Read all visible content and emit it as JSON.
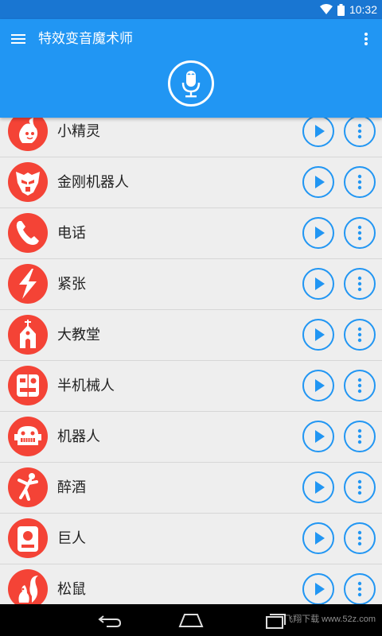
{
  "status": {
    "time": "10:32"
  },
  "appbar": {
    "title": "特效变音魔术师"
  },
  "list": {
    "items": [
      {
        "name": "小精灵",
        "icon": "fairy-icon"
      },
      {
        "name": "金刚机器人",
        "icon": "transformer-robot-icon"
      },
      {
        "name": "电话",
        "icon": "phone-icon"
      },
      {
        "name": "紧张",
        "icon": "lightning-icon"
      },
      {
        "name": "大教堂",
        "icon": "church-icon"
      },
      {
        "name": "半机械人",
        "icon": "cyborg-icon"
      },
      {
        "name": "机器人",
        "icon": "robot-icon"
      },
      {
        "name": "醉酒",
        "icon": "drunk-person-icon"
      },
      {
        "name": "巨人",
        "icon": "giant-icon"
      },
      {
        "name": "松鼠",
        "icon": "squirrel-icon"
      }
    ]
  },
  "watermark": {
    "text": "飞翔下载 www.52z.com"
  },
  "colors": {
    "primary": "#2196f3",
    "primary_dark": "#1976d2",
    "avatar": "#f44336"
  }
}
